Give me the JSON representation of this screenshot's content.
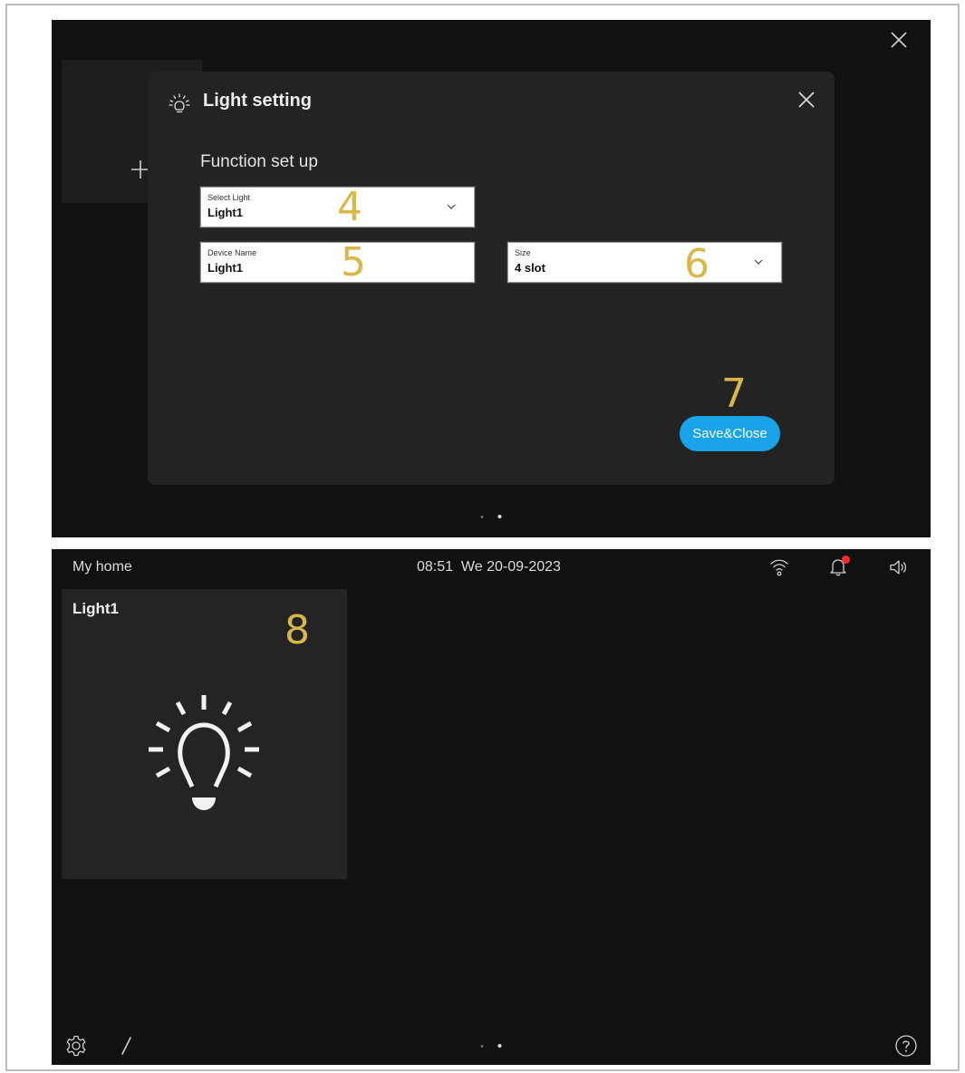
{
  "screen1": {
    "dialog": {
      "title": "Light setting",
      "section_title": "Function set up",
      "fields": {
        "select_light": {
          "label": "Select Light",
          "value": "Light1"
        },
        "device_name": {
          "label": "Device Name",
          "value": "Light1"
        },
        "size": {
          "label": "Size",
          "value": "4 slot"
        }
      },
      "save_label": "Save&Close"
    },
    "callouts": {
      "c4": "4",
      "c5": "5",
      "c6": "6",
      "c7": "7"
    },
    "icons": {
      "plus": "plus-icon",
      "close": "close-icon",
      "title": "light-bulb-icon",
      "chevron": "chevron-down-icon"
    }
  },
  "screen2": {
    "home_title": "My home",
    "clock": "08:51  We 20-09-2023",
    "tile": {
      "label": "Light1"
    },
    "callouts": {
      "c8": "8"
    },
    "icons": {
      "wifi": "wifi-icon",
      "bell": "bell-icon",
      "speaker": "speaker-icon",
      "bulb": "light-bulb-icon",
      "gear": "gear-icon",
      "pencil": "pencil-icon",
      "help": "help-icon"
    }
  },
  "colors": {
    "screen_bg": "#111111",
    "dialog_bg": "#232323",
    "tile_bg": "#242424",
    "accent": "#1aa3e8",
    "callout": "#d9b84a",
    "notification": "#ff2a2a"
  }
}
